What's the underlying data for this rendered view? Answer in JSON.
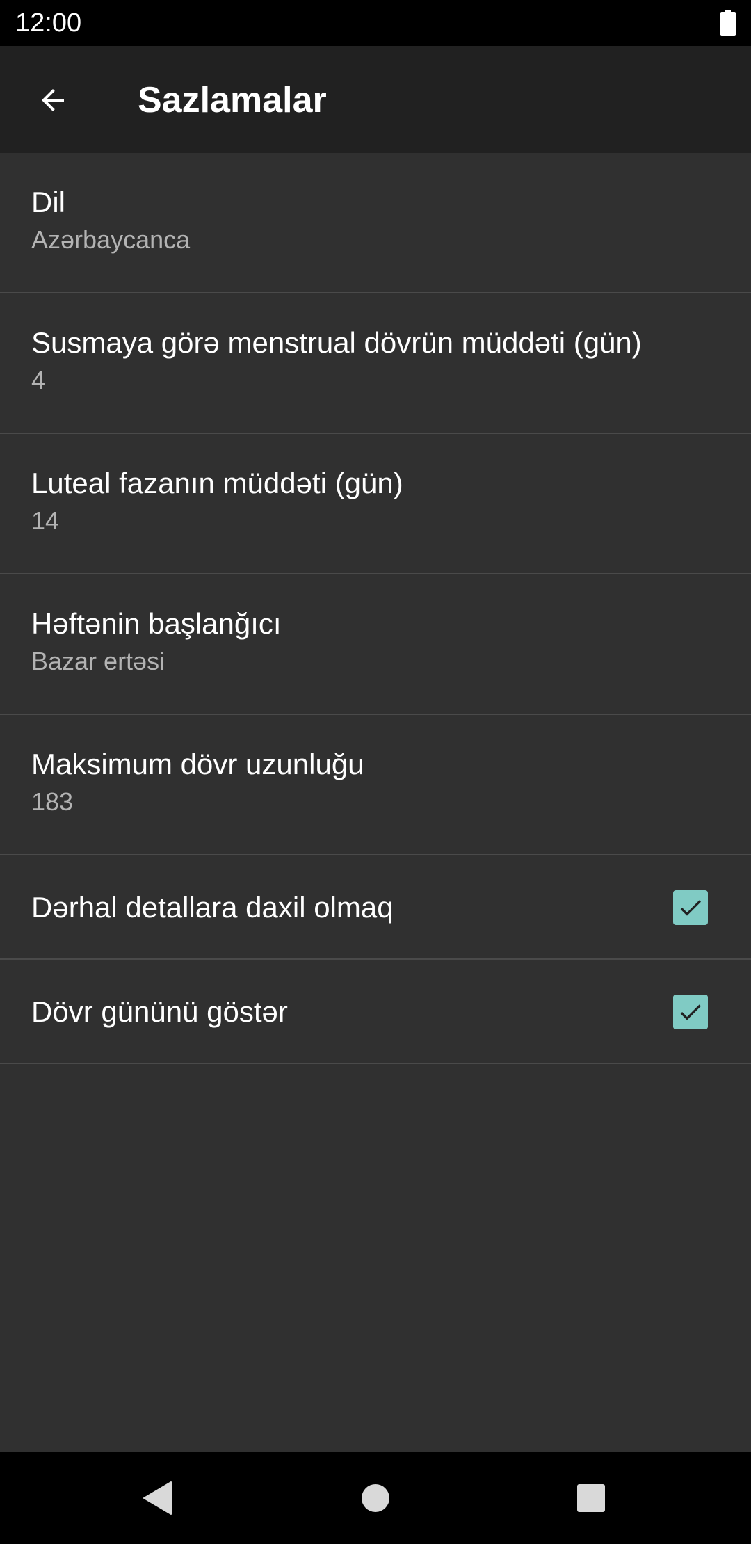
{
  "status_bar": {
    "time": "12:00",
    "battery_icon": "battery-full-icon"
  },
  "app_bar": {
    "back_icon": "arrow-back-icon",
    "title": "Sazlamalar"
  },
  "preferences": [
    {
      "title": "Dil",
      "summary": "Azərbaycanca"
    },
    {
      "title": "Susmaya görə menstrual dövrün müddəti (gün)",
      "summary": "4"
    },
    {
      "title": "Luteal fazanın müddəti (gün)",
      "summary": "14"
    },
    {
      "title": "Həftənin başlanğıcı",
      "summary": "Bazar ertəsi"
    },
    {
      "title": "Maksimum dövr uzunluğu",
      "summary": "183"
    }
  ],
  "checkbox_preferences": [
    {
      "title": "Dərhal detallara daxil olmaq",
      "checked": true
    },
    {
      "title": "Dövr gününü göstər",
      "checked": true
    }
  ],
  "nav_bar": {
    "back_icon": "nav-back-triangle-icon",
    "home_icon": "nav-home-circle-icon",
    "recents_icon": "nav-recents-square-icon"
  },
  "colors": {
    "background": "#303030",
    "app_bar": "#212121",
    "status_bar": "#000000",
    "divider": "#4a4a4a",
    "accent_checkbox": "#80cbc4",
    "primary_text": "#ffffff",
    "secondary_text": "#b3b3b3"
  }
}
